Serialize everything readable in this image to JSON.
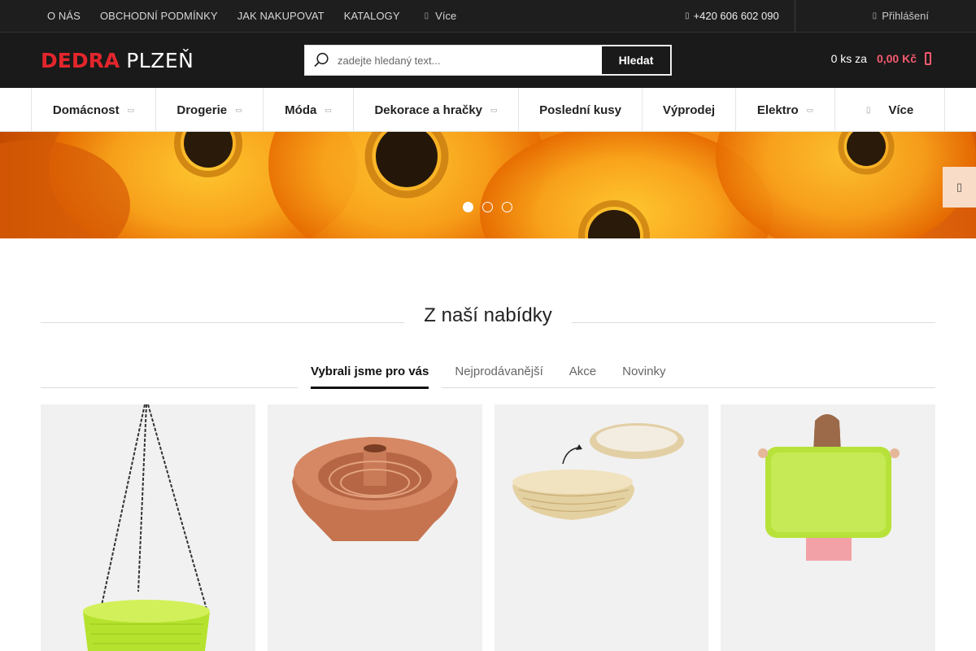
{
  "topbar": {
    "links": [
      "O NÁS",
      "OBCHODNÍ PODMÍNKY",
      "JAK NAKUPOVAT",
      "KATALOGY"
    ],
    "more_label": "Více",
    "phone": "+420 606 602 090",
    "login": "Přihlášení"
  },
  "header": {
    "logo_red": "DEDRA",
    "logo_white": "PLZEŇ",
    "search_placeholder": "zadejte hledaný text...",
    "search_button": "Hledat",
    "cart_count": "0 ks za",
    "cart_price": "0,00 Kč"
  },
  "categories": [
    {
      "label": "Domácnost",
      "has_sub": true
    },
    {
      "label": "Drogerie",
      "has_sub": true
    },
    {
      "label": "Móda",
      "has_sub": true
    },
    {
      "label": "Dekorace a hračky",
      "has_sub": true
    },
    {
      "label": "Poslední kusy",
      "has_sub": false
    },
    {
      "label": "Výprodej",
      "has_sub": false
    },
    {
      "label": "Elektro",
      "has_sub": true
    },
    {
      "label": "Více",
      "has_sub": false
    }
  ],
  "banner": {
    "slides": 3,
    "active_slide": 1
  },
  "offers": {
    "title": "Z naší nabídky",
    "tabs": [
      "Vybrali jsme pro vás",
      "Nejprodávanější",
      "Akce",
      "Novinky"
    ],
    "active_tab": 0
  },
  "products": [
    {
      "image": "hanging-planter"
    },
    {
      "image": "bundt-cake-mold"
    },
    {
      "image": "bread-proofing-basket"
    },
    {
      "image": "green-tray"
    }
  ],
  "colors": {
    "accent": "#f45b6e",
    "logo_red": "#e3262c",
    "dark": "#1a1a1a"
  }
}
